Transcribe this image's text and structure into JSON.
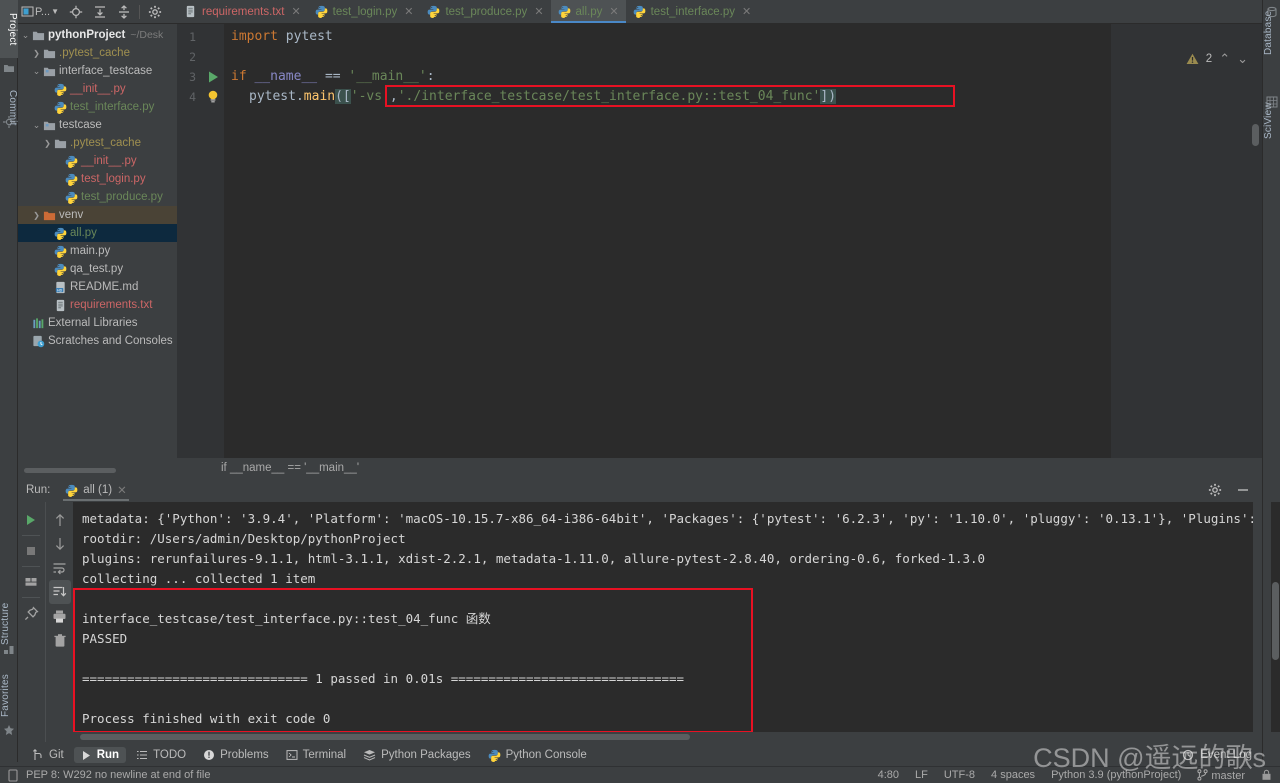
{
  "window": {
    "left_tool_tabs": [
      {
        "label": "Project",
        "icon": "folder-icon",
        "active": true
      },
      {
        "label": "Commit",
        "icon": "commit-icon",
        "active": false
      },
      {
        "label": "Structure",
        "icon": "structure-icon",
        "active": false
      },
      {
        "label": "Favorites",
        "icon": "star-icon",
        "active": false
      }
    ],
    "right_tool_tabs": [
      {
        "label": "Database",
        "icon": "database-icon"
      },
      {
        "label": "SciView",
        "icon": "sciview-icon"
      }
    ]
  },
  "project_toolbar": {
    "selector_label": "P...",
    "buttons": [
      {
        "name": "project-selector",
        "label": "P..."
      },
      {
        "name": "locate-icon",
        "label": ""
      },
      {
        "name": "expand-all-icon",
        "label": ""
      },
      {
        "name": "collapse-all-icon",
        "label": ""
      },
      {
        "name": "gear-icon",
        "label": ""
      }
    ]
  },
  "project_tree": [
    {
      "indent": 0,
      "arrow": "down",
      "icon": "folder-icon",
      "label": "pythonProject",
      "sub": "~/Desk",
      "style": "white",
      "selected": false
    },
    {
      "indent": 1,
      "arrow": "right",
      "icon": "folder-excluded-icon",
      "label": ".pytest_cache",
      "sub": "",
      "style": "olive",
      "selected": false
    },
    {
      "indent": 1,
      "arrow": "down",
      "icon": "folder-source-icon",
      "label": "interface_testcase",
      "sub": "",
      "style": "plain",
      "selected": false
    },
    {
      "indent": 2,
      "arrow": "none",
      "icon": "python-file-icon",
      "label": "__init__.py",
      "sub": "",
      "style": "red",
      "selected": false
    },
    {
      "indent": 2,
      "arrow": "none",
      "icon": "python-file-icon",
      "label": "test_interface.py",
      "sub": "",
      "style": "green",
      "selected": false
    },
    {
      "indent": 1,
      "arrow": "down",
      "icon": "folder-source-icon",
      "label": "testcase",
      "sub": "",
      "style": "plain",
      "selected": false
    },
    {
      "indent": 2,
      "arrow": "right",
      "icon": "folder-icon",
      "label": ".pytest_cache",
      "sub": "",
      "style": "olive",
      "selected": false
    },
    {
      "indent": 3,
      "arrow": "none",
      "icon": "python-file-icon",
      "label": "__init__.py",
      "sub": "",
      "style": "red",
      "selected": false
    },
    {
      "indent": 3,
      "arrow": "none",
      "icon": "python-file-icon",
      "label": "test_login.py",
      "sub": "",
      "style": "red",
      "selected": false
    },
    {
      "indent": 3,
      "arrow": "none",
      "icon": "python-file-icon",
      "label": "test_produce.py",
      "sub": "",
      "style": "green",
      "selected": false
    },
    {
      "indent": 1,
      "arrow": "right",
      "icon": "folder-venv-icon",
      "label": "venv",
      "sub": "",
      "style": "plain",
      "selected": "hover"
    },
    {
      "indent": 2,
      "arrow": "none",
      "icon": "python-file-icon",
      "label": "all.py",
      "sub": "",
      "style": "green",
      "selected": true
    },
    {
      "indent": 2,
      "arrow": "none",
      "icon": "python-file-icon",
      "label": "main.py",
      "sub": "",
      "style": "plain",
      "selected": false
    },
    {
      "indent": 2,
      "arrow": "none",
      "icon": "python-file-icon",
      "label": "qa_test.py",
      "sub": "",
      "style": "plain",
      "selected": false
    },
    {
      "indent": 2,
      "arrow": "none",
      "icon": "markdown-file-icon",
      "label": "README.md",
      "sub": "",
      "style": "plain",
      "selected": false
    },
    {
      "indent": 2,
      "arrow": "none",
      "icon": "text-file-icon",
      "label": "requirements.txt",
      "sub": "",
      "style": "red",
      "selected": false
    },
    {
      "indent": 0,
      "arrow": "none",
      "icon": "library-icon",
      "label": "External Libraries",
      "sub": "",
      "style": "plain",
      "selected": false
    },
    {
      "indent": 0,
      "arrow": "none",
      "icon": "scratches-icon",
      "label": "Scratches and Consoles",
      "sub": "",
      "style": "plain",
      "selected": false
    }
  ],
  "editor_tabs": [
    {
      "label": "requirements.txt",
      "icon": "text-file-icon",
      "kind": "txt",
      "active": false
    },
    {
      "label": "test_login.py",
      "icon": "python-file-icon",
      "kind": "py",
      "active": false
    },
    {
      "label": "test_produce.py",
      "icon": "python-file-icon",
      "kind": "py",
      "active": false
    },
    {
      "label": "all.py",
      "icon": "python-file-icon",
      "kind": "py",
      "active": true
    },
    {
      "label": "test_interface.py",
      "icon": "python-file-icon",
      "kind": "py",
      "active": false
    }
  ],
  "editor": {
    "line_numbers": [
      "1",
      "2",
      "3",
      "4"
    ],
    "code": {
      "l1_kw": "import",
      "l1_rest": " pytest",
      "l3_kw": "if",
      "l3_name": " __name__ ",
      "l3_op": "== ",
      "l3_str": "'__main__'",
      "l3_colon": ":",
      "l4_obj": "pytest.",
      "l4_fn": "main",
      "l4_open": "([",
      "l4_arg1": "'-vs'",
      "l4_comma": ",",
      "l4_arg2": "'./interface_testcase/test_interface.py::test_04_func'",
      "l4_close": "])"
    },
    "inspection_warning_count": "2",
    "breadcrumb": "if __name__ == '__main__'"
  },
  "run_panel": {
    "label": "Run:",
    "tab_label": "all (1)",
    "toolbar_icons": [
      "run-icon",
      "stop-icon",
      "layout-icon",
      "pin-icon",
      "scroll-up-icon",
      "scroll-down-icon",
      "soft-wrap-icon",
      "scroll-to-end-icon",
      "print-icon",
      "trash-icon"
    ],
    "settings_icon": "gear-icon",
    "minimize_icon": "minimize-icon"
  },
  "console": {
    "lines": [
      "metadata: {'Python': '3.9.4', 'Platform': 'macOS-10.15.7-x86_64-i386-64bit', 'Packages': {'pytest': '6.2.3', 'py': '1.10.0', 'pluggy': '0.13.1'}, 'Plugins': {'",
      "rootdir: /Users/admin/Desktop/pythonProject",
      "plugins: rerunfailures-9.1.1, html-3.1.1, xdist-2.2.1, metadata-1.11.0, allure-pytest-2.8.40, ordering-0.6, forked-1.3.0",
      "collecting ... collected 1 item",
      "",
      "interface_testcase/test_interface.py::test_04_func 函数",
      "PASSED",
      "",
      "============================== 1 passed in 0.01s ===============================",
      "",
      "Process finished with exit code 0"
    ]
  },
  "bottom_toolbar": [
    {
      "label": "Git",
      "icon": "git-icon",
      "active": false
    },
    {
      "label": "Run",
      "icon": "run-icon",
      "active": true
    },
    {
      "label": "TODO",
      "icon": "todo-icon",
      "active": false
    },
    {
      "label": "Problems",
      "icon": "problems-icon",
      "active": false
    },
    {
      "label": "Terminal",
      "icon": "terminal-icon",
      "active": false
    },
    {
      "label": "Python Packages",
      "icon": "packages-icon",
      "active": false
    },
    {
      "label": "Python Console",
      "icon": "python-console-icon",
      "active": false
    }
  ],
  "bottom_toolbar_right": {
    "label": "Event Log",
    "icon": "event-log-icon"
  },
  "statusbar": {
    "message": "PEP 8: W292 no newline at end of file",
    "caret": "4:80",
    "line_separator": "LF",
    "encoding": "UTF-8",
    "indent": "4 spaces",
    "interpreter": "Python 3.9 (pythonProject)",
    "branch": "master",
    "branch_icon": "branch-icon",
    "lock_icon": "lock-icon"
  },
  "watermark": "CSDN @遥远的歌s",
  "colors": {
    "bg_panel": "#3c3f41",
    "bg_editor": "#2b2b2b",
    "accent_tab": "#4a88c7",
    "selection": "#0d293e",
    "red_box": "#e81123",
    "green_str": "#6a8759",
    "orange_kw": "#cc7832",
    "yellow_fn": "#ffc66d",
    "red_file": "#cc6666"
  }
}
